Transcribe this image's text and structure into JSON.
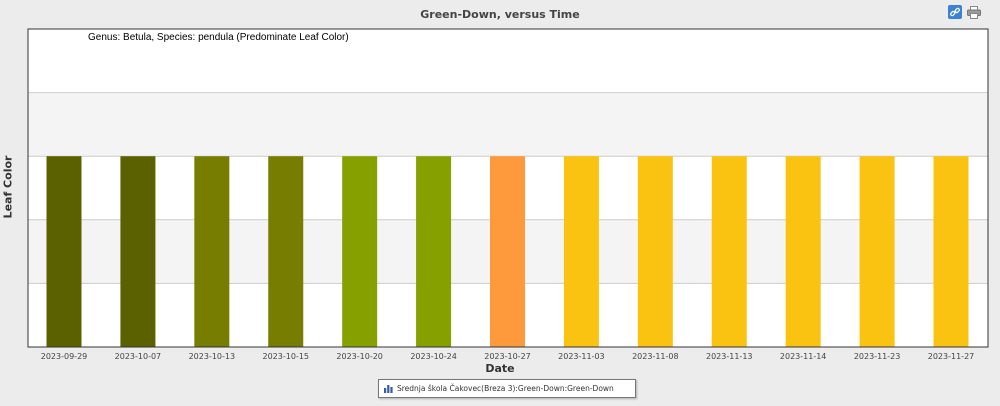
{
  "chart_data": {
    "type": "bar",
    "title": "Green-Down, versus Time",
    "subtitle": "Genus: Betula, Species: pendula (Predominate Leaf Color)",
    "xlabel": "Date",
    "ylabel": "Leaf Color",
    "categories": [
      "2023-09-29",
      "2023-10-07",
      "2023-10-13",
      "2023-10-15",
      "2023-10-20",
      "2023-10-24",
      "2023-10-27",
      "2023-11-03",
      "2023-11-08",
      "2023-11-13",
      "2023-11-14",
      "2023-11-23",
      "2023-11-27"
    ],
    "values": [
      1,
      1,
      1,
      1,
      1,
      1,
      1,
      1,
      1,
      1,
      1,
      1,
      1
    ],
    "bar_colors": [
      "#5c6100",
      "#5c6100",
      "#777d00",
      "#777d00",
      "#86a000",
      "#86a000",
      "#ff9a3c",
      "#fbc311",
      "#fbc311",
      "#fbc311",
      "#fbc311",
      "#fbc311",
      "#fbc311"
    ],
    "ylim": [
      0,
      1.667
    ],
    "grid": true,
    "legend": {
      "placement": "bottom-center",
      "entries": [
        "Srednja škola Čakovec(Breza 3):Green-Down:Green-Down"
      ],
      "icon": "bar-chart-icon"
    }
  },
  "toolbar": {
    "link_icon": "link-icon",
    "print_icon": "print-icon"
  }
}
